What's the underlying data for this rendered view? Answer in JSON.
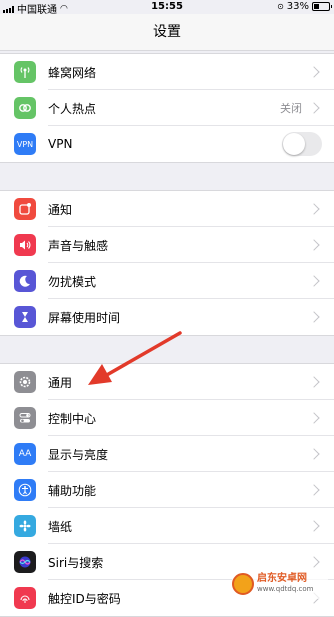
{
  "status_bar": {
    "carrier": "中国联通",
    "time": "15:55",
    "battery": "33%"
  },
  "nav": {
    "title": "设置"
  },
  "groups": [
    [
      {
        "label": "蜂窝网络",
        "icon": "cellular-icon",
        "color": "#65c466"
      },
      {
        "label": "个人热点",
        "value": "关闭",
        "icon": "hotspot-icon",
        "color": "#65c466"
      },
      {
        "label": "VPN",
        "icon": "vpn-icon",
        "icon_text": "VPN",
        "color": "#2f7cf6",
        "toggle": false
      }
    ],
    [
      {
        "label": "通知",
        "icon": "notifications-icon",
        "color": "#f04a3e"
      },
      {
        "label": "声音与触感",
        "icon": "sound-icon",
        "color": "#f0394f"
      },
      {
        "label": "勿扰模式",
        "icon": "moon-icon",
        "color": "#5856d6"
      },
      {
        "label": "屏幕使用时间",
        "icon": "hourglass-icon",
        "color": "#5856d6"
      }
    ],
    [
      {
        "label": "通用",
        "icon": "gear-icon",
        "color": "#8e8e93"
      },
      {
        "label": "控制中心",
        "icon": "control-center-icon",
        "color": "#8e8e93"
      },
      {
        "label": "显示与亮度",
        "icon": "display-icon",
        "icon_text": "AA",
        "color": "#2f7cf6"
      },
      {
        "label": "辅助功能",
        "icon": "accessibility-icon",
        "color": "#2f7cf6"
      },
      {
        "label": "墙纸",
        "icon": "wallpaper-icon",
        "color": "#35a9e0"
      },
      {
        "label": "Siri与搜索",
        "icon": "siri-icon",
        "color": "#1c1c1e"
      },
      {
        "label": "触控ID与密码",
        "icon": "touch-id-icon",
        "color": "#f0394f"
      }
    ]
  ],
  "watermark": {
    "name": "启东安卓网",
    "url": "www.qdtdq.com"
  }
}
